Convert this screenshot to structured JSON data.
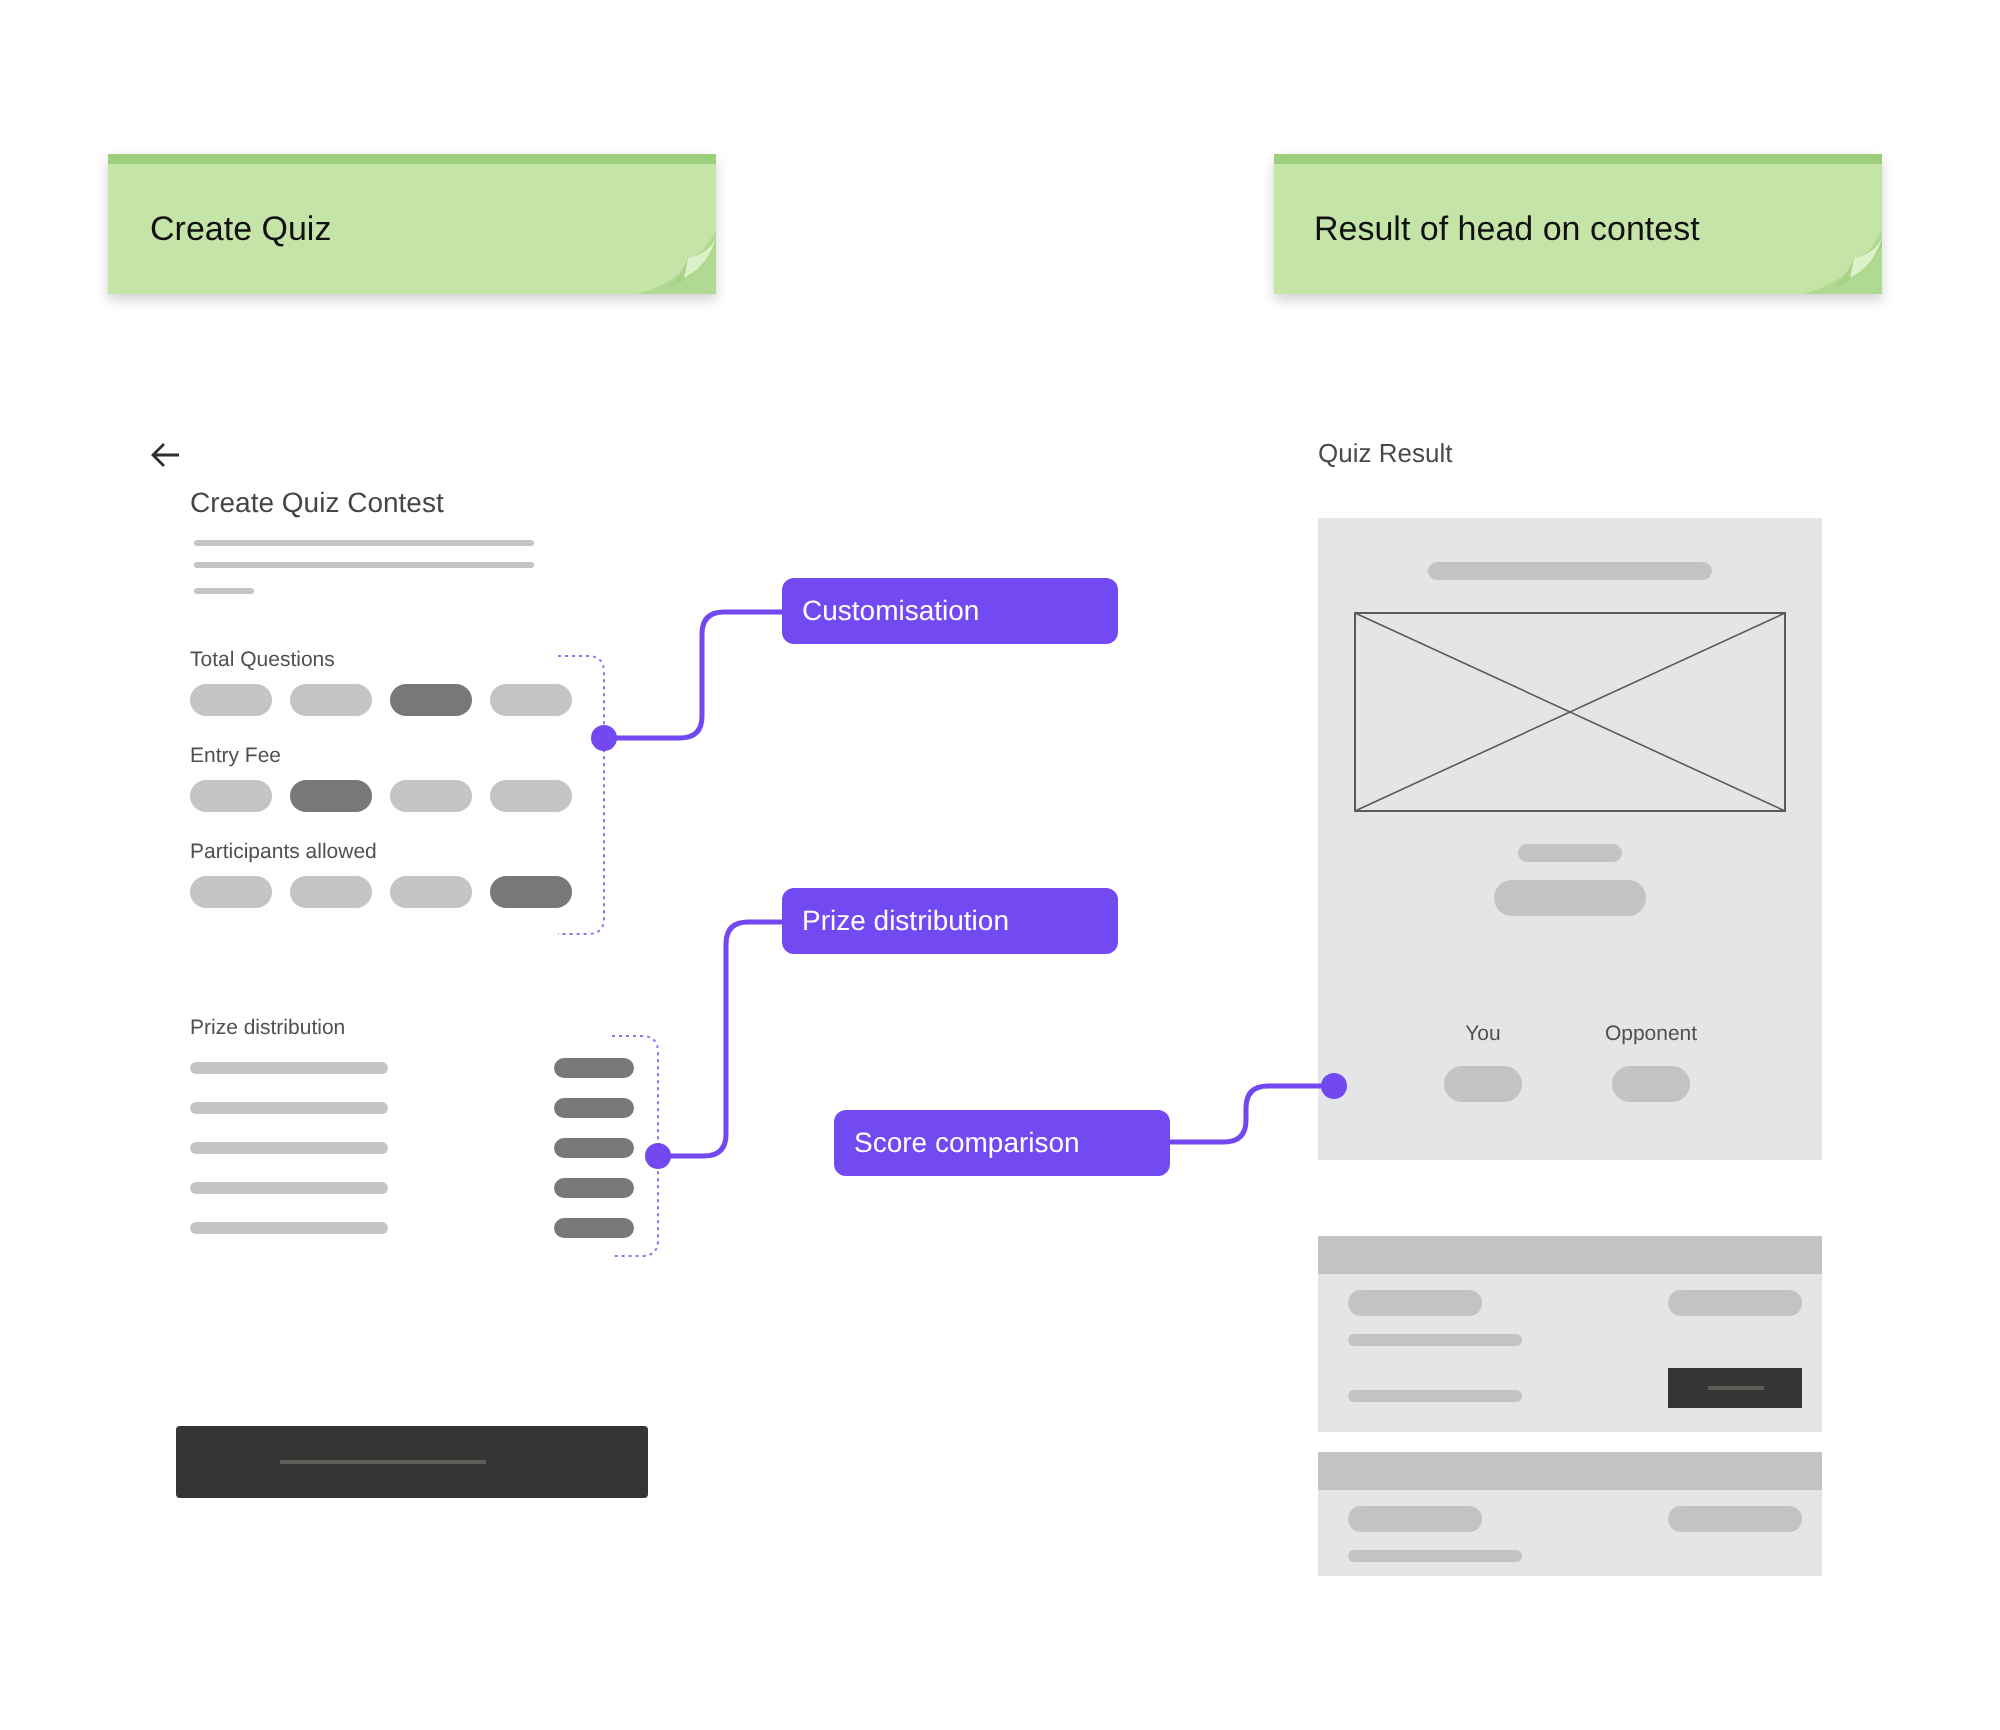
{
  "sticky_notes": [
    {
      "text": "Create Quiz"
    },
    {
      "text": "Result of head on contest"
    }
  ],
  "create_screen": {
    "title": "Create Quiz Contest",
    "option_groups": [
      {
        "label": "Total Questions",
        "options": [
          {
            "selected": false
          },
          {
            "selected": false
          },
          {
            "selected": true
          },
          {
            "selected": false
          }
        ]
      },
      {
        "label": "Entry Fee",
        "options": [
          {
            "selected": false
          },
          {
            "selected": true
          },
          {
            "selected": false
          },
          {
            "selected": false
          }
        ]
      },
      {
        "label": "Participants allowed",
        "options": [
          {
            "selected": false
          },
          {
            "selected": false
          },
          {
            "selected": false
          },
          {
            "selected": true
          }
        ]
      }
    ],
    "prize_label": "Prize distribution"
  },
  "callouts": [
    {
      "text": "Customisation"
    },
    {
      "text": "Prize distribution"
    },
    {
      "text": "Score comparison"
    }
  ],
  "result_screen": {
    "title": "Quiz Result",
    "score_labels": [
      "You",
      "Opponent"
    ]
  }
}
